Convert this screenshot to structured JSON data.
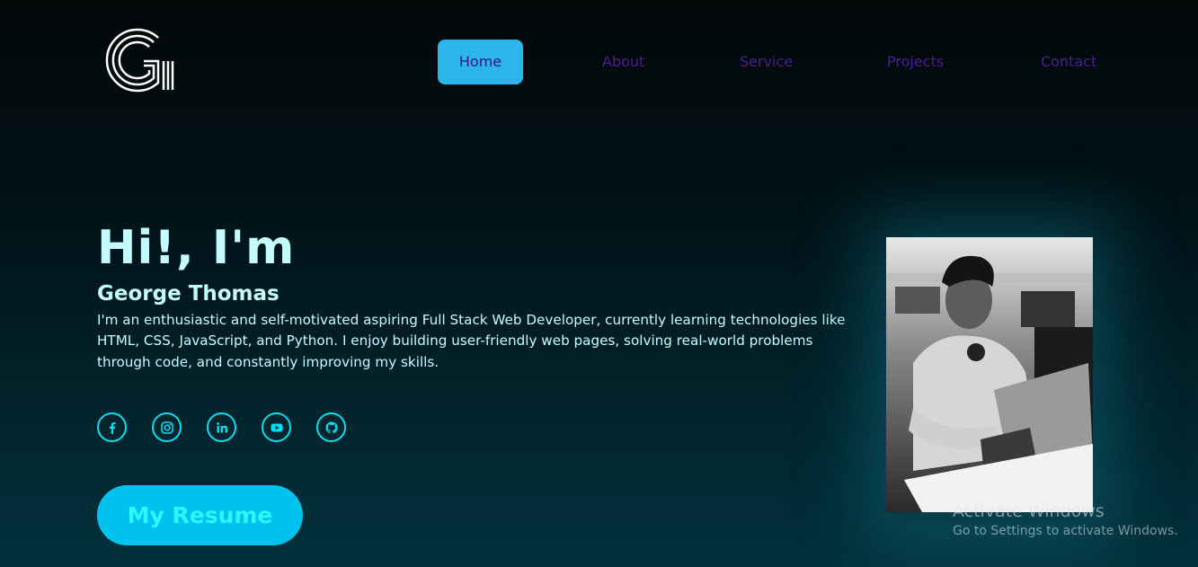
{
  "logo": {
    "name": "g-logo"
  },
  "nav": {
    "items": [
      {
        "label": "Home",
        "active": true
      },
      {
        "label": "About"
      },
      {
        "label": "Service"
      },
      {
        "label": "Projects"
      },
      {
        "label": "Contact"
      }
    ]
  },
  "hero": {
    "greeting": "Hi!, I'm",
    "name": "George Thomas",
    "description": "I'm an enthusiastic and self-motivated aspiring Full Stack Web Developer, currently learning technologies like HTML, CSS, JavaScript, and Python. I enjoy building user-friendly web pages, solving real-world problems through code, and constantly improving my skills.",
    "resume_label": "My Resume"
  },
  "socials": [
    {
      "icon": "facebook-icon"
    },
    {
      "icon": "instagram-icon"
    },
    {
      "icon": "linkedin-icon"
    },
    {
      "icon": "youtube-icon"
    },
    {
      "icon": "github-icon"
    }
  ],
  "watermark": {
    "line1": "Activate Windows",
    "line2": "Go to Settings to activate Windows."
  },
  "colors": {
    "accent": "#00c2ee",
    "nav_active": "#2ab6ea",
    "nav_text": "#4a1e93",
    "text": "#c4fbff"
  }
}
